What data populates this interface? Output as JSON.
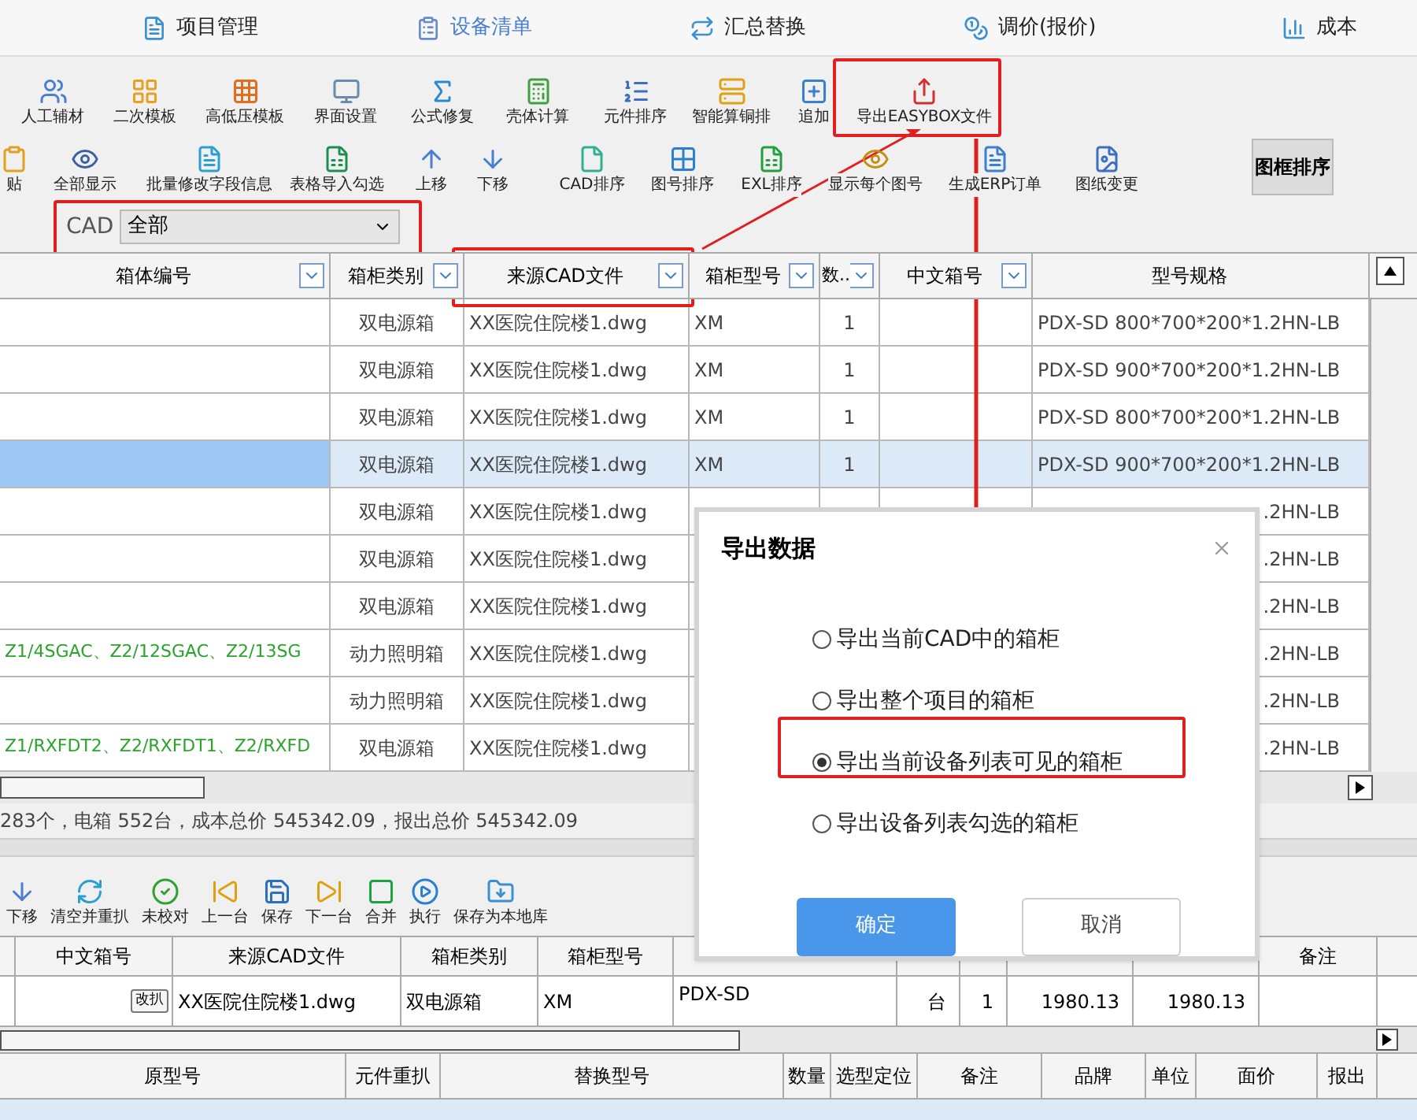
{
  "nav_tabs": [
    {
      "label": "项目管理",
      "selected": false
    },
    {
      "label": "设备清单",
      "selected": true
    },
    {
      "label": "汇总替换",
      "selected": false
    },
    {
      "label": "调价(报价)",
      "selected": false
    },
    {
      "label": "成本",
      "selected": false
    }
  ],
  "toolbar_1": [
    "人工辅材",
    "二次模板",
    "高低压模板",
    "界面设置",
    "公式修复",
    "壳体计算",
    "元件排序",
    "智能算铜排",
    "追加",
    "导出EASYBOX文件"
  ],
  "toolbar_2": [
    "贴",
    "全部显示",
    "批量修改字段信息",
    "表格导入勾选",
    "上移",
    "下移",
    "CAD排序",
    "图号排序",
    "EXL排序",
    "显示每个图号",
    "生成ERP订单",
    "图纸变更"
  ],
  "frame_sort_button": "图框排序",
  "cad_filter": {
    "label": "CAD",
    "value": "全部"
  },
  "main_table": {
    "columns": [
      {
        "label": "箱体编号",
        "filter": true
      },
      {
        "label": "箱柜类别",
        "filter": true
      },
      {
        "label": "来源CAD文件",
        "filter": true
      },
      {
        "label": "箱柜型号",
        "filter": true
      },
      {
        "label": "数..",
        "filter": true
      },
      {
        "label": "中文箱号",
        "filter": true
      },
      {
        "label": "型号规格",
        "filter": false
      }
    ],
    "rows": [
      {
        "selected": false,
        "cells": [
          "",
          "双电源箱",
          "XX医院住院楼1.dwg",
          "XM",
          "1",
          "",
          "PDX-SD 800*700*200*1.2HN-LB"
        ]
      },
      {
        "selected": false,
        "cells": [
          "",
          "双电源箱",
          "XX医院住院楼1.dwg",
          "XM",
          "1",
          "",
          "PDX-SD 900*700*200*1.2HN-LB"
        ]
      },
      {
        "selected": false,
        "cells": [
          "",
          "双电源箱",
          "XX医院住院楼1.dwg",
          "XM",
          "1",
          "",
          "PDX-SD 800*700*200*1.2HN-LB"
        ]
      },
      {
        "selected": true,
        "cells": [
          "",
          "双电源箱",
          "XX医院住院楼1.dwg",
          "XM",
          "1",
          "",
          "PDX-SD 900*700*200*1.2HN-LB"
        ]
      },
      {
        "selected": false,
        "cells": [
          "",
          "双电源箱",
          "XX医院住院楼1.dwg",
          "",
          "",
          "",
          ".2HN-LB"
        ]
      },
      {
        "selected": false,
        "cells": [
          "",
          "双电源箱",
          "XX医院住院楼1.dwg",
          "",
          "",
          "",
          ".2HN-LB"
        ]
      },
      {
        "selected": false,
        "cells": [
          "",
          "双电源箱",
          "XX医院住院楼1.dwg",
          "",
          "",
          "",
          ".2HN-LB"
        ]
      },
      {
        "selected": false,
        "cells": [
          "Z1/4SGAC、Z2/12SGAC、Z2/13SG",
          "动力照明箱",
          "XX医院住院楼1.dwg",
          "",
          "",
          "",
          ".2HN-LB"
        ]
      },
      {
        "selected": false,
        "cells": [
          "",
          "动力照明箱",
          "XX医院住院楼1.dwg",
          "",
          "",
          "",
          ".2HN-LB"
        ]
      },
      {
        "selected": false,
        "cells": [
          "Z1/RXFDT2、Z2/RXFDT1、Z2/RXFD",
          "双电源箱",
          "XX医院住院楼1.dwg",
          "",
          "",
          "",
          ".2HN-LB"
        ]
      }
    ]
  },
  "summary": "283个，电箱 552台，成本总价 545342.09，报出总价 545342.09",
  "toolbar_3": [
    "下移",
    "清空并重扒",
    "未校对",
    "上一台",
    "保存",
    "下一台",
    "合并",
    "执行",
    "保存为本地库"
  ],
  "detail_table": {
    "columns": [
      null,
      "中文箱号",
      "来源CAD文件",
      "箱柜类别",
      "箱柜型号",
      null,
      null,
      null,
      null,
      null,
      "备注"
    ],
    "row": [
      "改扒",
      "XX医院住院楼1.dwg",
      "双电源箱",
      "XM",
      "PDX-SD",
      "台",
      "1",
      "1980.13",
      "1980.13"
    ]
  },
  "parts_table": {
    "columns": [
      "原型号",
      "元件重扒",
      "替换型号",
      "数量",
      "选型定位",
      "备注",
      "品牌",
      "单位",
      "面价",
      "报出"
    ]
  },
  "dialog": {
    "title": "导出数据",
    "options": [
      {
        "label": "导出当前CAD中的箱柜",
        "selected": false
      },
      {
        "label": "导出整个项目的箱柜",
        "selected": false
      },
      {
        "label": "导出当前设备列表可见的箱柜",
        "selected": true
      },
      {
        "label": "导出设备列表勾选的箱柜",
        "selected": false
      }
    ],
    "ok": "确定",
    "cancel": "取消"
  }
}
